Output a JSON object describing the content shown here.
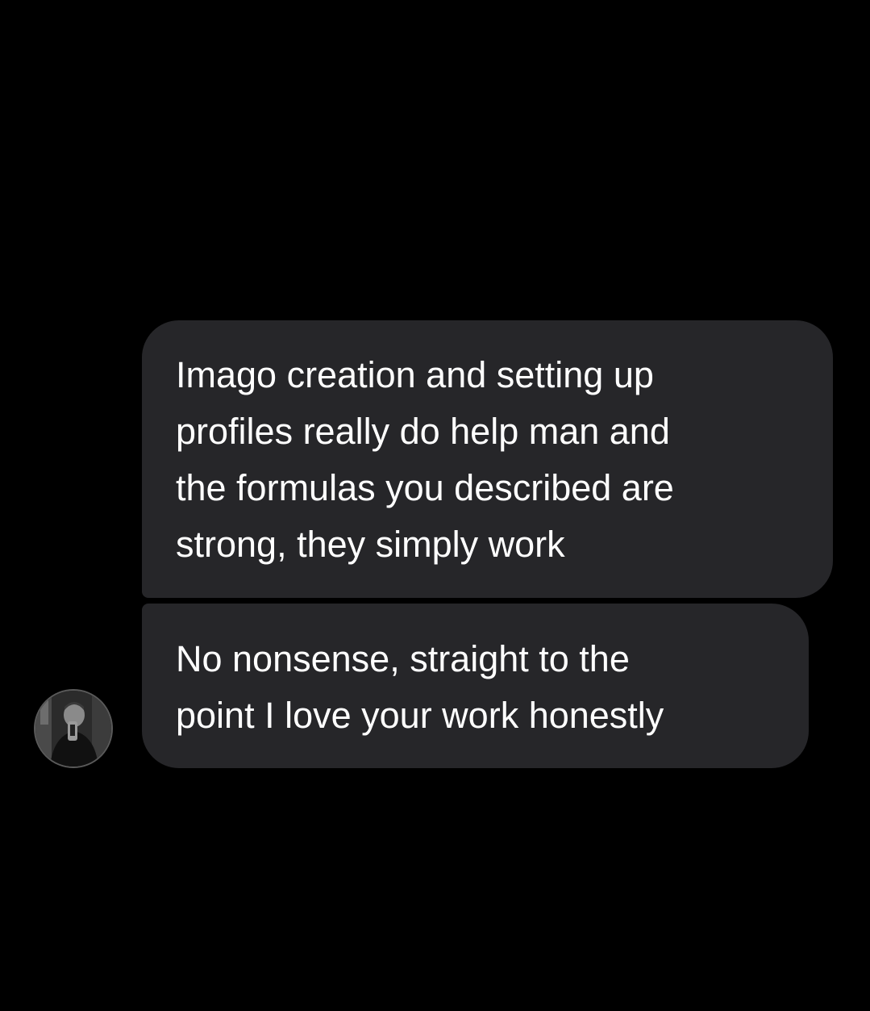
{
  "conversation": {
    "messages": [
      {
        "text": "Imago creation and setting up\nprofiles really do help man and\nthe formulas you described are\nstrong, they simply work"
      },
      {
        "text": "No nonsense, straight to the\npoint I love your work honestly"
      }
    ],
    "sender": {
      "avatar_icon": "profile-photo-avatar"
    }
  },
  "colors": {
    "background": "#000000",
    "bubble": "#262629",
    "text": "#ffffff"
  }
}
